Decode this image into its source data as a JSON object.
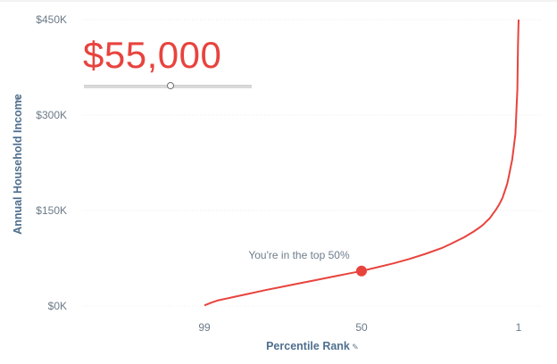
{
  "big_value": "$55,000",
  "slider": {
    "value": 55000,
    "min": 0,
    "max": 450000
  },
  "colors": {
    "line": "#e8433d",
    "marker": "#e8433d",
    "text_value": "#e8433d",
    "axis_text": "#6b7a88"
  },
  "icons": {
    "axis_pin": "pin-icon"
  },
  "chart_data": {
    "type": "line",
    "xlabel": "Percentile Rank",
    "ylabel": "Annual Household Income",
    "x_reversed": true,
    "xlim": [
      100,
      1
    ],
    "ylim": [
      0,
      450000
    ],
    "x_ticks": [
      99,
      50,
      1
    ],
    "x_tick_labels": [
      "99",
      "50",
      "1"
    ],
    "y_ticks": [
      0,
      150000,
      300000,
      450000
    ],
    "y_tick_labels": [
      "$0K",
      "$150K",
      "$300K",
      "$450K"
    ],
    "grid": true,
    "series": [
      {
        "x": [
          99,
          97,
          95,
          90,
          85,
          80,
          75,
          70,
          65,
          60,
          55,
          50,
          45,
          40,
          35,
          30,
          25,
          22,
          20,
          18,
          15,
          13,
          12,
          11,
          10,
          9,
          8,
          7,
          6,
          5,
          4.5,
          4,
          3,
          2.5,
          2,
          1.6,
          1.4,
          1.2,
          1
        ],
        "y": [
          1000,
          5000,
          8500,
          14000,
          19500,
          25000,
          30000,
          35000,
          40000,
          45000,
          50000,
          55000,
          61000,
          67000,
          74000,
          82000,
          91000,
          98000,
          103000,
          108000,
          117000,
          124000,
          128000,
          133000,
          138000,
          145000,
          152000,
          160000,
          170000,
          185000,
          193000,
          205000,
          230000,
          250000,
          270000,
          315000,
          340000,
          410000,
          450000
        ]
      }
    ],
    "marker": {
      "x": 50,
      "y": 55000
    },
    "annotation": "You're in the top 50%"
  }
}
